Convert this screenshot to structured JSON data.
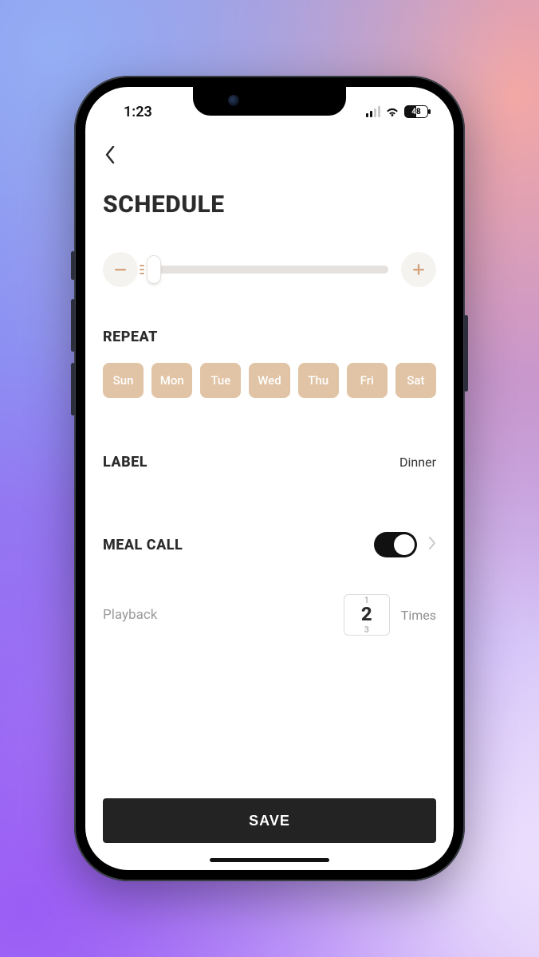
{
  "statusBar": {
    "time": "1:23",
    "batteryPercent": "48"
  },
  "header": {
    "title": "SCHEDULE"
  },
  "portionSlider": {
    "value": 0
  },
  "repeat": {
    "heading": "REPEAT",
    "days": [
      "Sun",
      "Mon",
      "Tue",
      "Wed",
      "Thu",
      "Fri",
      "Sat"
    ]
  },
  "label": {
    "heading": "LABEL",
    "value": "Dinner"
  },
  "mealCall": {
    "heading": "MEAL CALL",
    "enabled": true
  },
  "playback": {
    "label": "Playback",
    "prev": "1",
    "value": "2",
    "next": "3",
    "suffix": "Times"
  },
  "save": {
    "label": "SAVE"
  },
  "icons": {
    "minusColor": "#d3a47d",
    "plusColor": "#d3a47d"
  }
}
